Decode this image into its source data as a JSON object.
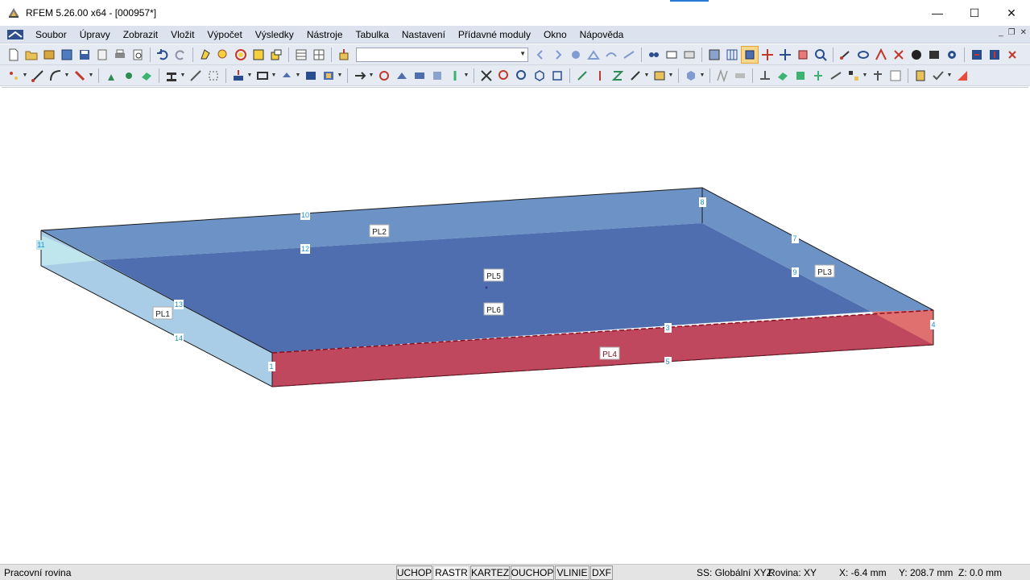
{
  "window": {
    "title": "RFEM 5.26.00 x64 - [000957*]",
    "minimize_glyph": "—",
    "maximize_glyph": "☐",
    "close_glyph": "✕",
    "mdi_minimize": "_",
    "mdi_restore": "❐",
    "mdi_close": "✕"
  },
  "menu": {
    "items": [
      "Soubor",
      "Úpravy",
      "Zobrazit",
      "Vložit",
      "Výpočet",
      "Výsledky",
      "Nástroje",
      "Tabulka",
      "Nastavení",
      "Přídavné moduly",
      "Okno",
      "Nápověda"
    ]
  },
  "toolbar": {
    "combo_value": ""
  },
  "model": {
    "colors": {
      "top": "#4e6eb0",
      "back": "#6d93c6",
      "left_end": "#a9cde6",
      "left_end_light": "#bfe6ec",
      "front": "#c0485e",
      "right_end": "#e0706f",
      "outline": "#1a1a1a",
      "front_dash": "#8a1020"
    },
    "surface_labels": {
      "pl1": "PL1",
      "pl2": "PL2",
      "pl3": "PL3",
      "pl4": "PL4",
      "pl5": "PL5",
      "pl6": "PL6"
    },
    "line_labels": {
      "n1": "1",
      "n3": "3",
      "n4": "4",
      "n5": "5",
      "n7": "7",
      "n8": "8",
      "n9": "9",
      "n10": "10",
      "n11": "11",
      "n12": "12",
      "n13": "13",
      "n14": "14"
    }
  },
  "status": {
    "left_text": "Pracovní rovina",
    "buttons": [
      "UCHOP",
      "RASTR",
      "KARTEZ",
      "OUCHOP",
      "VLINIE",
      "DXF"
    ],
    "coord_system": "SS: Globální XYZ",
    "plane": "Rovina: XY",
    "x": "X:  -6.4 mm",
    "y": "Y:  208.7 mm",
    "z": "Z:  0.0 mm"
  }
}
